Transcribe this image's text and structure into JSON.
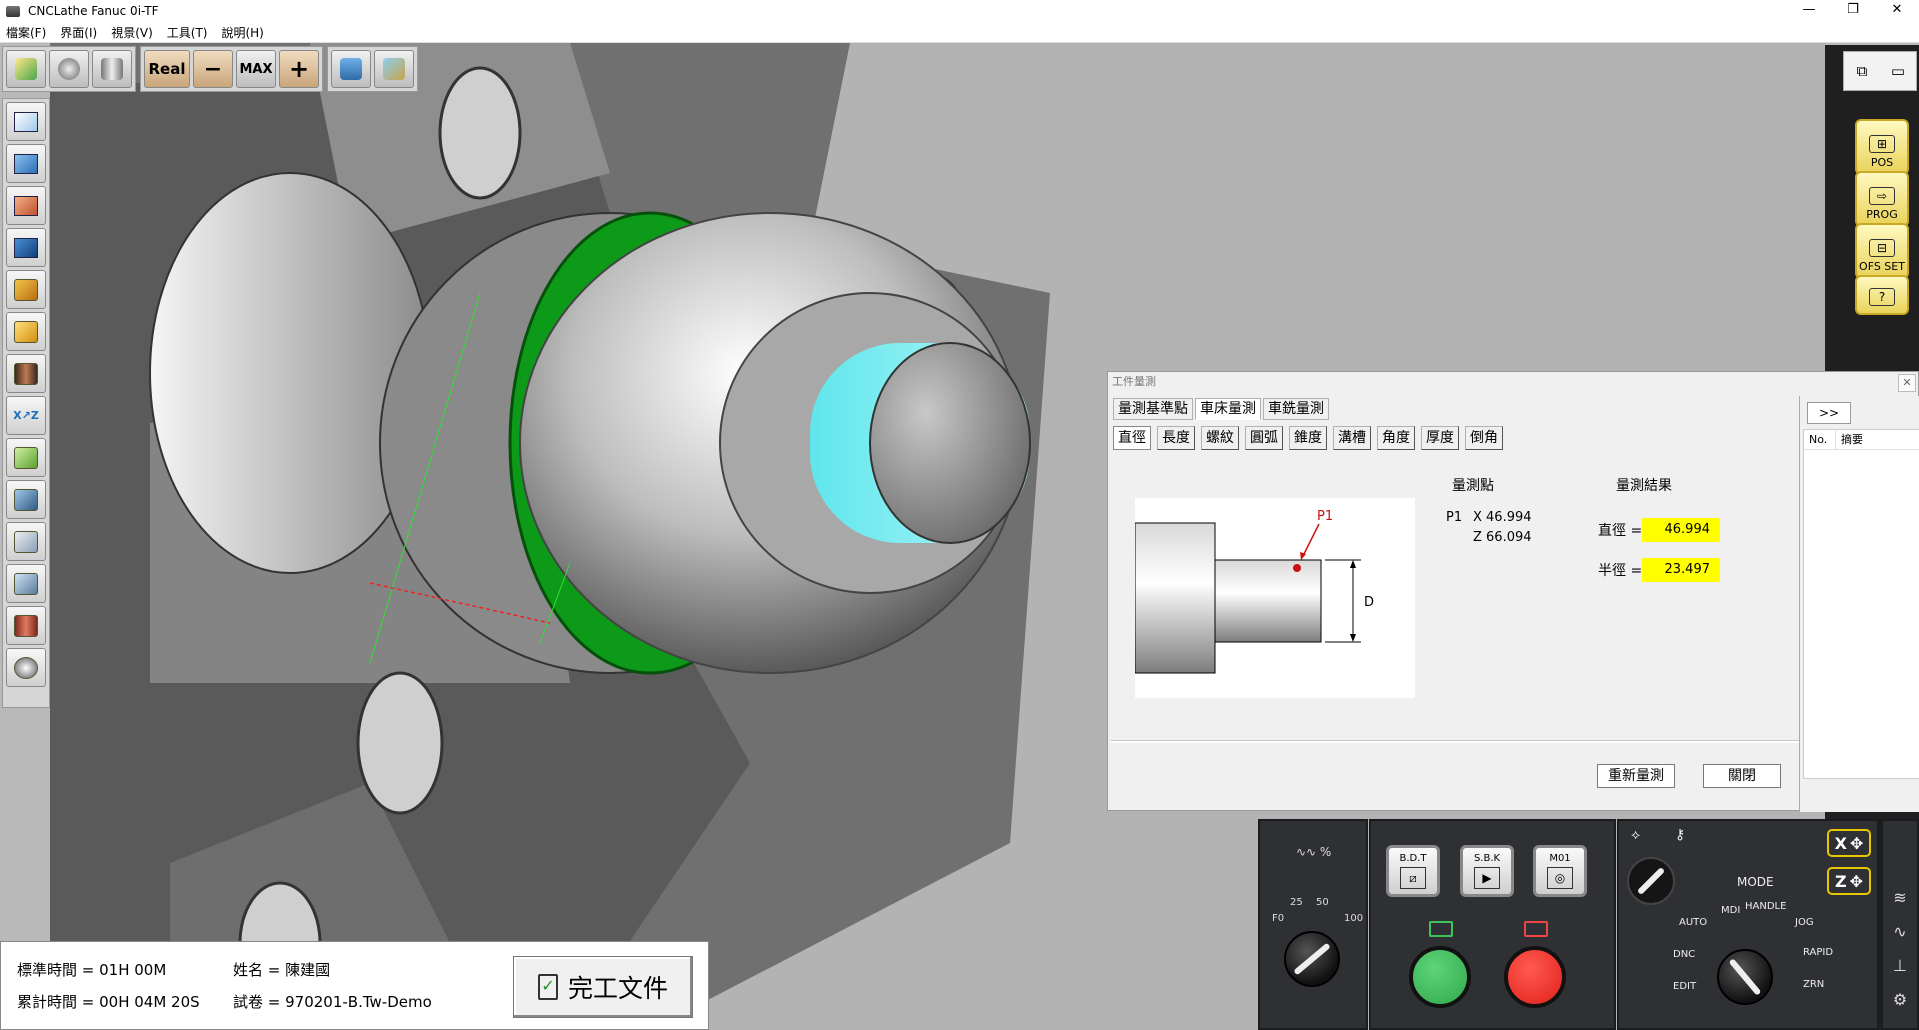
{
  "window": {
    "title": "CNCLathe Fanuc 0i-TF",
    "controls": [
      "—",
      "❐",
      "✕"
    ]
  },
  "menu": [
    "檔案(F)",
    "界面(I)",
    "視景(V)",
    "工具(T)",
    "說明(H)"
  ],
  "toolbar": {
    "real_label": "Real",
    "minus_label": "−",
    "max_label": "MAX",
    "plus_label": "+"
  },
  "right_panel": {
    "softkeys": [
      {
        "label": "POS",
        "icon": "position-icon"
      },
      {
        "label": "PROG",
        "icon": "program-icon"
      },
      {
        "label": "OFS SET",
        "icon": "offset-setting-icon"
      },
      {
        "label": "?",
        "icon": "help-icon"
      }
    ]
  },
  "dialog": {
    "title": "工件量測",
    "close": "✕",
    "top_tabs": [
      "量測基準點",
      "車床量測",
      "車銑量測"
    ],
    "active_top_tab": "車床量測",
    "sub_tabs": [
      "直徑",
      "長度",
      "螺紋",
      "圓弧",
      "錐度",
      "溝槽",
      "角度",
      "厚度",
      "倒角"
    ],
    "active_sub_tab": "直徑",
    "diagram": {
      "point_label": "P1",
      "dimension_label": "D"
    },
    "measure_point_title": "量測點",
    "result_title": "量測結果",
    "point": {
      "name": "P1",
      "x": "X 46.994",
      "z": "Z 66.094"
    },
    "results": [
      {
        "label": "直徑 =",
        "value": "46.994"
      },
      {
        "label": "半徑 =",
        "value": "23.497"
      }
    ],
    "remeasure_button": "重新量測",
    "close_button": "關閉",
    "history": {
      "expand": ">>",
      "col_no": "No.",
      "col_summary": "摘要"
    }
  },
  "info": {
    "std_time": "標準時間 = 01H 00M",
    "acc_time": "累計時間 = 00H 04M 20S",
    "name": "姓名 = 陳建國",
    "exam": "試卷 = 970201-B.Tw-Demo",
    "done_button": "完工文件"
  },
  "feed_panel": {
    "label": "∿∿ %",
    "ticks": [
      "F0",
      "25",
      "50",
      "100"
    ]
  },
  "key_panel": {
    "bdt": "B.D.T",
    "sbk": "S.B.K",
    "m01": "M01"
  },
  "mode_panel": {
    "title": "MODE",
    "labels": [
      "AUTO",
      "MDI",
      "HANDLE",
      "JOG",
      "RAPID",
      "ZRN",
      "DNC",
      "EDIT"
    ],
    "x_button": "X",
    "z_button": "Z"
  },
  "colors": {
    "highlight": "#ffff00",
    "cycle_start": "#2fa84a",
    "feed_hold": "#e0201a"
  }
}
